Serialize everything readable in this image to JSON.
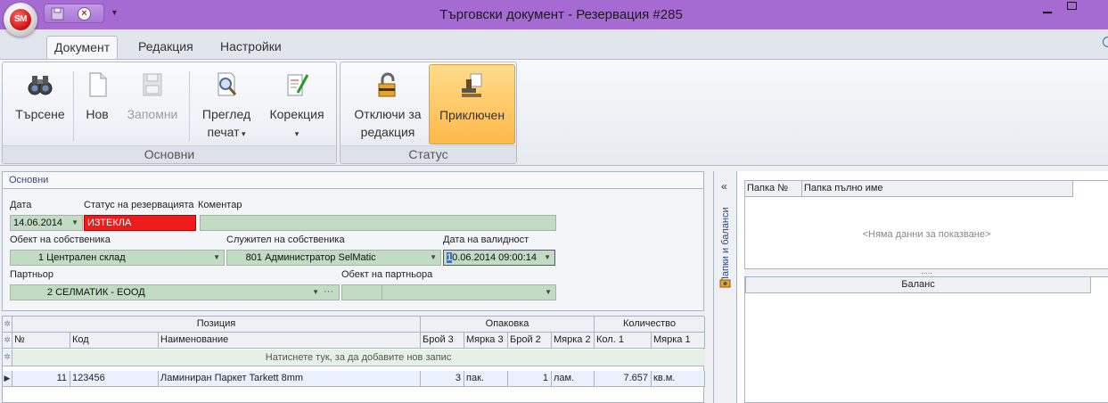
{
  "window": {
    "title": "Търговски документ - Резервация #285",
    "logo_text": "SM"
  },
  "ribbon": {
    "tabs": [
      "Документ",
      "Редакция",
      "Настройки"
    ],
    "active_tab": "Документ",
    "groups": {
      "basic": {
        "label": "Основни",
        "search": "Търсене",
        "new": "Нов",
        "save": "Запомни",
        "preview_1": "Преглед",
        "preview_2": "печат",
        "correction": "Корекция"
      },
      "status": {
        "label": "Статус",
        "unlock_1": "Отключи за",
        "unlock_2": "редакция",
        "completed": "Приключен"
      }
    }
  },
  "form": {
    "section_title": "Основни",
    "date_label": "Дата",
    "date_value": "14.06.2014",
    "status_label": "Статус на резервацията",
    "status_value": "ИЗТЕКЛА",
    "comment_label": "Коментар",
    "comment_value": "",
    "owner_object_label": "Обект на собственика",
    "owner_object_num": "1",
    "owner_object_name": "Централен склад",
    "owner_employee_label": "Служител на собственика",
    "owner_employee_num": "801",
    "owner_employee_name": "Администратор SelMatic",
    "validity_label": "Дата на валидност",
    "validity_cursor": "1",
    "validity_rest": "0.06.2014 09:00:14",
    "partner_label": "Партньор",
    "partner_num": "2",
    "partner_name": "СЕЛМАТИК - ЕООД",
    "partner_object_label": "Обект на партньора",
    "partner_object_value": ""
  },
  "grid": {
    "band_headers": [
      "Позиция",
      "Опаковка",
      "Количество"
    ],
    "columns": [
      "№",
      "Код",
      "Наименование",
      "Брой 3",
      "Мярка 3",
      "Брой 2",
      "Мярка 2",
      "Кол. 1",
      "Мярка 1"
    ],
    "new_row_text": "Натиснете тук, за да добавите нов запис",
    "rows": [
      {
        "no": "11",
        "code": "123456",
        "name": "Ламиниран Паркет Tarkett 8mm",
        "qty3": "3",
        "unit3": "пак.",
        "qty2": "1",
        "unit2": "лам.",
        "qty1": "7.657",
        "unit1": "кв.м."
      }
    ]
  },
  "side_panel": {
    "vertical_title": "Папки и баланси",
    "collapse_glyph": "«",
    "folder_columns": [
      "Папка №",
      "Папка пълно име"
    ],
    "no_data": "<Няма данни за показване>",
    "balance_header": "Баланс"
  }
}
